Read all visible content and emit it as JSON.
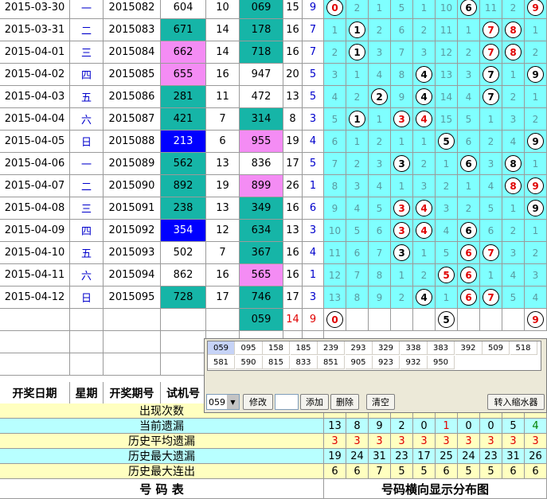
{
  "colors": {
    "teal": "#16b5a7",
    "pink": "#f48cf4",
    "blue": "#0000ff",
    "cyan": "#7fffff",
    "yellow": "#ffffc0",
    "lightcyan": "#b8ffff",
    "red": "#e00000"
  },
  "rows": [
    {
      "date": "2015-03-30",
      "wk": "一",
      "period": "2015082",
      "trial": "604",
      "tbg": "white",
      "span": "10",
      "win": "069",
      "wbg": "teal",
      "sum": "15",
      "tail": "9",
      "digits": [
        {
          "v": "0",
          "ball": true,
          "red": true
        },
        {
          "v": "2"
        },
        {
          "v": "1"
        },
        {
          "v": "5"
        },
        {
          "v": "1"
        },
        {
          "v": "10"
        },
        {
          "v": "6",
          "ball": true
        },
        {
          "v": "11"
        },
        {
          "v": "2"
        },
        {
          "v": "9",
          "ball": true,
          "red": true
        }
      ]
    },
    {
      "date": "2015-03-31",
      "wk": "二",
      "period": "2015083",
      "trial": "671",
      "tbg": "teal",
      "span": "14",
      "win": "178",
      "wbg": "teal",
      "sum": "16",
      "tail": "7",
      "digits": [
        {
          "v": "1"
        },
        {
          "v": "1",
          "ball": true
        },
        {
          "v": "2"
        },
        {
          "v": "6"
        },
        {
          "v": "2"
        },
        {
          "v": "11"
        },
        {
          "v": "1"
        },
        {
          "v": "7",
          "ball": true,
          "red": true
        },
        {
          "v": "8",
          "ball": true,
          "red": true
        },
        {
          "v": "1"
        }
      ]
    },
    {
      "date": "2015-04-01",
      "wk": "三",
      "period": "2015084",
      "trial": "662",
      "tbg": "pink",
      "span": "14",
      "win": "718",
      "wbg": "teal",
      "sum": "16",
      "tail": "7",
      "digits": [
        {
          "v": "2"
        },
        {
          "v": "1",
          "ball": true
        },
        {
          "v": "3"
        },
        {
          "v": "7"
        },
        {
          "v": "3"
        },
        {
          "v": "12"
        },
        {
          "v": "2"
        },
        {
          "v": "7",
          "ball": true,
          "red": true
        },
        {
          "v": "8",
          "ball": true,
          "red": true
        },
        {
          "v": "2"
        }
      ]
    },
    {
      "date": "2015-04-02",
      "wk": "四",
      "period": "2015085",
      "trial": "655",
      "tbg": "pink",
      "span": "16",
      "win": "947",
      "wbg": "white",
      "sum": "20",
      "tail": "5",
      "digits": [
        {
          "v": "3"
        },
        {
          "v": "1"
        },
        {
          "v": "4"
        },
        {
          "v": "8"
        },
        {
          "v": "4",
          "ball": true
        },
        {
          "v": "13"
        },
        {
          "v": "3"
        },
        {
          "v": "7",
          "ball": true
        },
        {
          "v": "1"
        },
        {
          "v": "9",
          "ball": true
        }
      ]
    },
    {
      "date": "2015-04-03",
      "wk": "五",
      "period": "2015086",
      "trial": "281",
      "tbg": "teal",
      "span": "11",
      "win": "472",
      "wbg": "white",
      "sum": "13",
      "tail": "5",
      "digits": [
        {
          "v": "4"
        },
        {
          "v": "2"
        },
        {
          "v": "2",
          "ball": true
        },
        {
          "v": "9"
        },
        {
          "v": "4",
          "ball": true
        },
        {
          "v": "14"
        },
        {
          "v": "4"
        },
        {
          "v": "7",
          "ball": true
        },
        {
          "v": "2"
        },
        {
          "v": "1"
        }
      ]
    },
    {
      "date": "2015-04-04",
      "wk": "六",
      "period": "2015087",
      "trial": "421",
      "tbg": "teal",
      "span": "7",
      "win": "314",
      "wbg": "teal",
      "sum": "8",
      "tail": "3",
      "digits": [
        {
          "v": "5"
        },
        {
          "v": "1",
          "ball": true
        },
        {
          "v": "1"
        },
        {
          "v": "3",
          "ball": true,
          "red": true
        },
        {
          "v": "4",
          "ball": true,
          "red": true
        },
        {
          "v": "15"
        },
        {
          "v": "5"
        },
        {
          "v": "1"
        },
        {
          "v": "3"
        },
        {
          "v": "2"
        }
      ]
    },
    {
      "date": "2015-04-05",
      "wk": "日",
      "period": "2015088",
      "trial": "213",
      "tbg": "blue",
      "span": "6",
      "win": "955",
      "wbg": "pink",
      "sum": "19",
      "tail": "4",
      "digits": [
        {
          "v": "6"
        },
        {
          "v": "1"
        },
        {
          "v": "2"
        },
        {
          "v": "1"
        },
        {
          "v": "1"
        },
        {
          "v": "5",
          "ball": true
        },
        {
          "v": "6"
        },
        {
          "v": "2"
        },
        {
          "v": "4"
        },
        {
          "v": "9",
          "ball": true
        }
      ]
    },
    {
      "date": "2015-04-06",
      "wk": "一",
      "period": "2015089",
      "trial": "562",
      "tbg": "teal",
      "span": "13",
      "win": "836",
      "wbg": "white",
      "sum": "17",
      "tail": "5",
      "digits": [
        {
          "v": "7"
        },
        {
          "v": "2"
        },
        {
          "v": "3"
        },
        {
          "v": "3",
          "ball": true
        },
        {
          "v": "2"
        },
        {
          "v": "1"
        },
        {
          "v": "6",
          "ball": true
        },
        {
          "v": "3"
        },
        {
          "v": "8",
          "ball": true
        },
        {
          "v": "1"
        }
      ]
    },
    {
      "date": "2015-04-07",
      "wk": "二",
      "period": "2015090",
      "trial": "892",
      "tbg": "teal",
      "span": "19",
      "win": "899",
      "wbg": "pink",
      "sum": "26",
      "tail": "1",
      "digits": [
        {
          "v": "8"
        },
        {
          "v": "3"
        },
        {
          "v": "4"
        },
        {
          "v": "1"
        },
        {
          "v": "3"
        },
        {
          "v": "2"
        },
        {
          "v": "1"
        },
        {
          "v": "4"
        },
        {
          "v": "8",
          "ball": true,
          "red": true
        },
        {
          "v": "9",
          "ball": true,
          "red": true
        }
      ]
    },
    {
      "date": "2015-04-08",
      "wk": "三",
      "period": "2015091",
      "trial": "238",
      "tbg": "teal",
      "span": "13",
      "win": "349",
      "wbg": "teal",
      "sum": "16",
      "tail": "6",
      "digits": [
        {
          "v": "9"
        },
        {
          "v": "4"
        },
        {
          "v": "5"
        },
        {
          "v": "3",
          "ball": true,
          "red": true
        },
        {
          "v": "4",
          "ball": true,
          "red": true
        },
        {
          "v": "3"
        },
        {
          "v": "2"
        },
        {
          "v": "5"
        },
        {
          "v": "1"
        },
        {
          "v": "9",
          "ball": true
        }
      ]
    },
    {
      "date": "2015-04-09",
      "wk": "四",
      "period": "2015092",
      "trial": "354",
      "tbg": "blue",
      "span": "12",
      "win": "634",
      "wbg": "teal",
      "sum": "13",
      "tail": "3",
      "digits": [
        {
          "v": "10"
        },
        {
          "v": "5"
        },
        {
          "v": "6"
        },
        {
          "v": "3",
          "ball": true,
          "red": true
        },
        {
          "v": "4",
          "ball": true,
          "red": true
        },
        {
          "v": "4"
        },
        {
          "v": "6",
          "ball": true
        },
        {
          "v": "6"
        },
        {
          "v": "2"
        },
        {
          "v": "1"
        }
      ]
    },
    {
      "date": "2015-04-10",
      "wk": "五",
      "period": "2015093",
      "trial": "502",
      "tbg": "white",
      "span": "7",
      "win": "367",
      "wbg": "teal",
      "sum": "16",
      "tail": "4",
      "digits": [
        {
          "v": "11"
        },
        {
          "v": "6"
        },
        {
          "v": "7"
        },
        {
          "v": "3",
          "ball": true
        },
        {
          "v": "1"
        },
        {
          "v": "5"
        },
        {
          "v": "6",
          "ball": true,
          "red": true
        },
        {
          "v": "7",
          "ball": true,
          "red": true
        },
        {
          "v": "3"
        },
        {
          "v": "2"
        }
      ]
    },
    {
      "date": "2015-04-11",
      "wk": "六",
      "period": "2015094",
      "trial": "862",
      "tbg": "white",
      "span": "16",
      "win": "565",
      "wbg": "pink",
      "sum": "16",
      "tail": "1",
      "digits": [
        {
          "v": "12"
        },
        {
          "v": "7"
        },
        {
          "v": "8"
        },
        {
          "v": "1"
        },
        {
          "v": "2"
        },
        {
          "v": "5",
          "ball": true,
          "red": true
        },
        {
          "v": "6",
          "ball": true,
          "red": true
        },
        {
          "v": "1"
        },
        {
          "v": "4"
        },
        {
          "v": "3"
        }
      ]
    },
    {
      "date": "2015-04-12",
      "wk": "日",
      "period": "2015095",
      "trial": "728",
      "tbg": "teal",
      "span": "17",
      "win": "746",
      "wbg": "teal",
      "sum": "17",
      "tail": "3",
      "digits": [
        {
          "v": "13"
        },
        {
          "v": "8"
        },
        {
          "v": "9"
        },
        {
          "v": "2"
        },
        {
          "v": "4",
          "ball": true
        },
        {
          "v": "1"
        },
        {
          "v": "6",
          "ball": true,
          "red": true
        },
        {
          "v": "7",
          "ball": true,
          "red": true
        },
        {
          "v": "5"
        },
        {
          "v": "4"
        }
      ]
    }
  ],
  "predict": {
    "win": "059",
    "sum": "14",
    "tail": "9",
    "balls": [
      {
        "i": 0,
        "v": "0",
        "red": true
      },
      {
        "i": 5,
        "v": "5"
      },
      {
        "i": 9,
        "v": "9",
        "red": true
      }
    ]
  },
  "panel": {
    "row1": [
      "059",
      "095",
      "158",
      "185",
      "239",
      "293",
      "329",
      "338",
      "383",
      "392",
      "509",
      "518"
    ],
    "row2": [
      "581",
      "590",
      "815",
      "833",
      "851",
      "905",
      "923",
      "932",
      "950"
    ],
    "combo": "059",
    "modify": "修改",
    "add": "添加",
    "delete": "删除",
    "clear": "清空",
    "transfer": "转入缩水器"
  },
  "headers": {
    "date": "开奖日期",
    "week": "星期",
    "period": "开奖期号",
    "trial": "试机号"
  },
  "stats": [
    {
      "label": "出现次数",
      "bg": "yellow",
      "vals": [],
      "red": false
    },
    {
      "label": "当前遗漏",
      "bg": "lightcyan",
      "vals": [
        "13",
        "8",
        "9",
        "2",
        "0",
        "1",
        "0",
        "0",
        "5",
        "4"
      ],
      "colors": [
        "#000",
        "#000",
        "#000",
        "#000",
        "#000",
        "#e00000",
        "#000",
        "#000",
        "#000",
        "#008000"
      ]
    },
    {
      "label": "历史平均遗漏",
      "bg": "yellow",
      "vals": [
        "3",
        "3",
        "3",
        "3",
        "3",
        "3",
        "3",
        "3",
        "3",
        "3"
      ],
      "red": true
    },
    {
      "label": "历史最大遗漏",
      "bg": "lightcyan",
      "vals": [
        "19",
        "24",
        "31",
        "23",
        "17",
        "25",
        "24",
        "23",
        "31",
        "26"
      ],
      "red": false
    },
    {
      "label": "历史最大连出",
      "bg": "yellow",
      "vals": [
        "6",
        "6",
        "7",
        "5",
        "5",
        "6",
        "5",
        "5",
        "6",
        "6"
      ],
      "red": false
    }
  ],
  "footer": {
    "left": "号  码  表",
    "right": "号码横向显示分布图"
  }
}
